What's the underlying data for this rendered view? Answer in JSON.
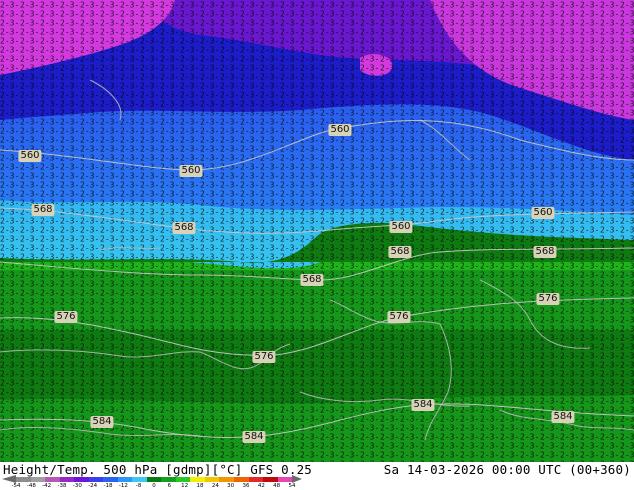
{
  "map": {
    "contour_labels": [
      "560",
      "560",
      "560",
      "560",
      "560",
      "568",
      "568",
      "568",
      "568",
      "568",
      "568",
      "576",
      "576",
      "576",
      "576",
      "576",
      "584",
      "584",
      "584",
      "584"
    ],
    "colors": {
      "magenta": "#d23ae0",
      "violet": "#7a1fd6",
      "blue_dark": "#1a14c8",
      "blue": "#2846f0",
      "blue_light": "#2c8cf6",
      "cyan": "#34c8f2",
      "green_dark": "#0f6e0f",
      "green": "#16961a",
      "green_light": "#1fb41c",
      "coast": "#aaaaaa"
    }
  },
  "footer": {
    "title": "Height/Temp. 500 hPa [gdmp][°C] GFS 0.25",
    "datetime": "Sa 14-03-2026 00:00 UTC (00+360)",
    "colorbar": {
      "ticks": [
        "-54",
        "-48",
        "-42",
        "-38",
        "-30",
        "-24",
        "-18",
        "-12",
        "-8",
        "0",
        "6",
        "12",
        "18",
        "24",
        "30",
        "36",
        "42",
        "48",
        "54"
      ],
      "colors": [
        "#8c8c8c",
        "#a0a0a0",
        "#b45ab4",
        "#9628c8",
        "#6e14dc",
        "#3c3cf0",
        "#2864f0",
        "#2c96fa",
        "#3cc8f0",
        "#0a7814",
        "#14a01e",
        "#28c828",
        "#f0f000",
        "#f0c800",
        "#f09600",
        "#f06400",
        "#e62828",
        "#be0a0a",
        "#e646b4"
      ]
    }
  }
}
